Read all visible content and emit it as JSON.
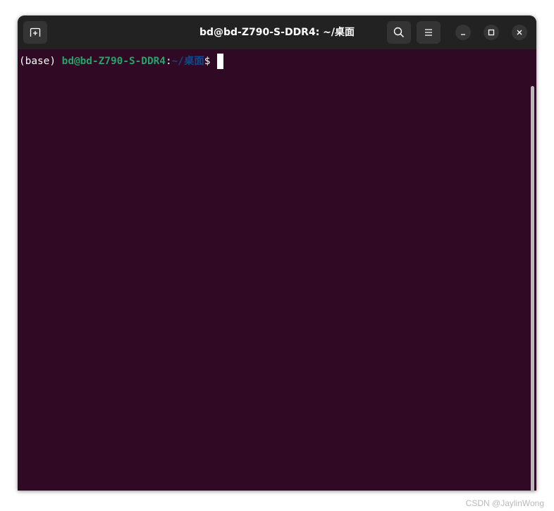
{
  "window": {
    "title": "bd@bd-Z790-S-DDR4: ~/桌面"
  },
  "titlebar": {
    "new_tab_icon": "new-tab-icon",
    "search_icon": "search-icon",
    "menu_icon": "hamburger-menu-icon",
    "minimize_icon": "minimize-icon",
    "maximize_icon": "maximize-icon",
    "close_icon": "close-icon"
  },
  "terminal": {
    "env": "(base)",
    "userhost": "bd@bd-Z790-S-DDR4",
    "colon": ":",
    "path": "~/桌面",
    "dollar": "$",
    "colors": {
      "background": "#300a24",
      "userhost": "#26a269",
      "path": "#12488b",
      "text": "#ffffff"
    }
  },
  "watermark": "CSDN @JaylinWong"
}
